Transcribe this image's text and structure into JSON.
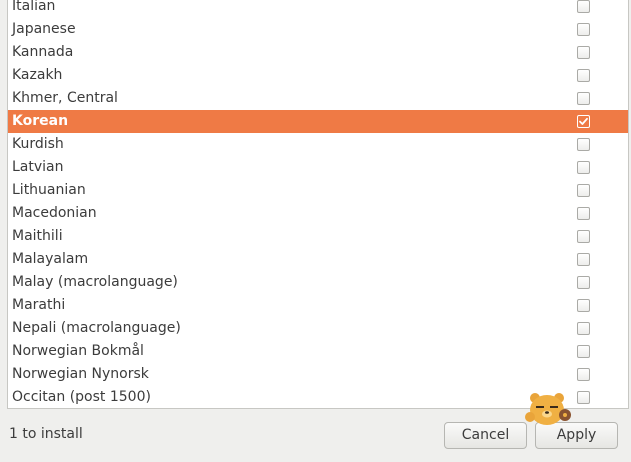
{
  "languages": [
    {
      "name": "Italian",
      "checked": false
    },
    {
      "name": "Japanese",
      "checked": false
    },
    {
      "name": "Kannada",
      "checked": false
    },
    {
      "name": "Kazakh",
      "checked": false
    },
    {
      "name": "Khmer, Central",
      "checked": false
    },
    {
      "name": "Korean",
      "checked": true
    },
    {
      "name": "Kurdish",
      "checked": false
    },
    {
      "name": "Latvian",
      "checked": false
    },
    {
      "name": "Lithuanian",
      "checked": false
    },
    {
      "name": "Macedonian",
      "checked": false
    },
    {
      "name": "Maithili",
      "checked": false
    },
    {
      "name": "Malayalam",
      "checked": false
    },
    {
      "name": "Malay (macrolanguage)",
      "checked": false
    },
    {
      "name": "Marathi",
      "checked": false
    },
    {
      "name": "Nepali (macrolanguage)",
      "checked": false
    },
    {
      "name": "Norwegian Bokmål",
      "checked": false
    },
    {
      "name": "Norwegian Nynorsk",
      "checked": false
    },
    {
      "name": "Occitan (post 1500)",
      "checked": false
    }
  ],
  "selected_language": "Korean",
  "footer": {
    "status_text": "1 to install",
    "cancel_label": "Cancel",
    "apply_label": "Apply"
  },
  "colors": {
    "selection": "#ef7a45",
    "window_bg": "#efefed",
    "list_bg": "#ffffff"
  },
  "icons": {
    "checkbox": "checkbox-icon",
    "checkmark": "checkmark-icon",
    "mascot": "bear-mascot-icon"
  }
}
